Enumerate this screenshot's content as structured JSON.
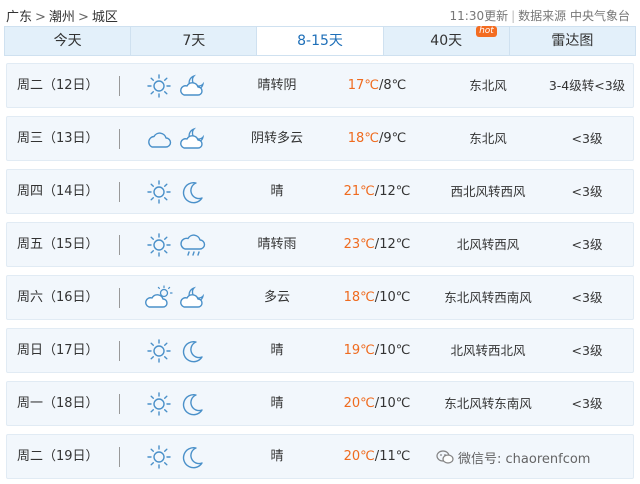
{
  "breadcrumb": {
    "province": "广东",
    "city": "潮州",
    "district": "城区",
    "sep": ">"
  },
  "meta": {
    "update": "11:30更新",
    "separator": "|",
    "source": "数据来源 中央气象台"
  },
  "tabs": [
    {
      "label": "今天",
      "active": false
    },
    {
      "label": "7天",
      "active": false
    },
    {
      "label": "8-15天",
      "active": true
    },
    {
      "label": "40天",
      "badge": "hot",
      "active": false
    },
    {
      "label": "雷达图",
      "active": false
    }
  ],
  "colors": {
    "accent": "#1e6fb8",
    "high_temp": "#ef6b1f",
    "row_bg": "#f2f7fc",
    "icon_stroke": "#4a90c9"
  },
  "forecast": [
    {
      "day": "周二（12日）",
      "icons": [
        "sun-icon",
        "partly-cloudy-night-icon"
      ],
      "desc": "晴转阴",
      "high": "17℃",
      "slash": "/",
      "low": "8℃",
      "wind": "东北风",
      "level": "3-4级转<3级"
    },
    {
      "day": "周三（13日）",
      "icons": [
        "cloud-icon",
        "partly-cloudy-night-icon"
      ],
      "desc": "阴转多云",
      "high": "18℃",
      "slash": "/",
      "low": "9℃",
      "wind": "东北风",
      "level": "<3级"
    },
    {
      "day": "周四（14日）",
      "icons": [
        "sun-icon",
        "moon-icon"
      ],
      "desc": "晴",
      "high": "21℃",
      "slash": "/",
      "low": "12℃",
      "wind": "西北风转西风",
      "level": "<3级"
    },
    {
      "day": "周五（15日）",
      "icons": [
        "sun-icon",
        "rain-cloud-icon"
      ],
      "desc": "晴转雨",
      "high": "23℃",
      "slash": "/",
      "low": "12℃",
      "wind": "北风转西风",
      "level": "<3级"
    },
    {
      "day": "周六（16日）",
      "icons": [
        "partly-cloudy-day-icon",
        "partly-cloudy-night-icon"
      ],
      "desc": "多云",
      "high": "18℃",
      "slash": "/",
      "low": "10℃",
      "wind": "东北风转西南风",
      "level": "<3级"
    },
    {
      "day": "周日（17日）",
      "icons": [
        "sun-icon",
        "moon-icon"
      ],
      "desc": "晴",
      "high": "19℃",
      "slash": "/",
      "low": "10℃",
      "wind": "北风转西北风",
      "level": "<3级"
    },
    {
      "day": "周一（18日）",
      "icons": [
        "sun-icon",
        "moon-icon"
      ],
      "desc": "晴",
      "high": "20℃",
      "slash": "/",
      "low": "10℃",
      "wind": "东北风转东南风",
      "level": "<3级"
    },
    {
      "day": "周二（19日）",
      "icons": [
        "sun-icon",
        "moon-icon"
      ],
      "desc": "晴",
      "high": "20℃",
      "slash": "/",
      "low": "11℃",
      "wind": "",
      "level": ""
    }
  ],
  "watermark": {
    "text": "微信号: chaorenfcom",
    "icon": "wechat-icon"
  }
}
